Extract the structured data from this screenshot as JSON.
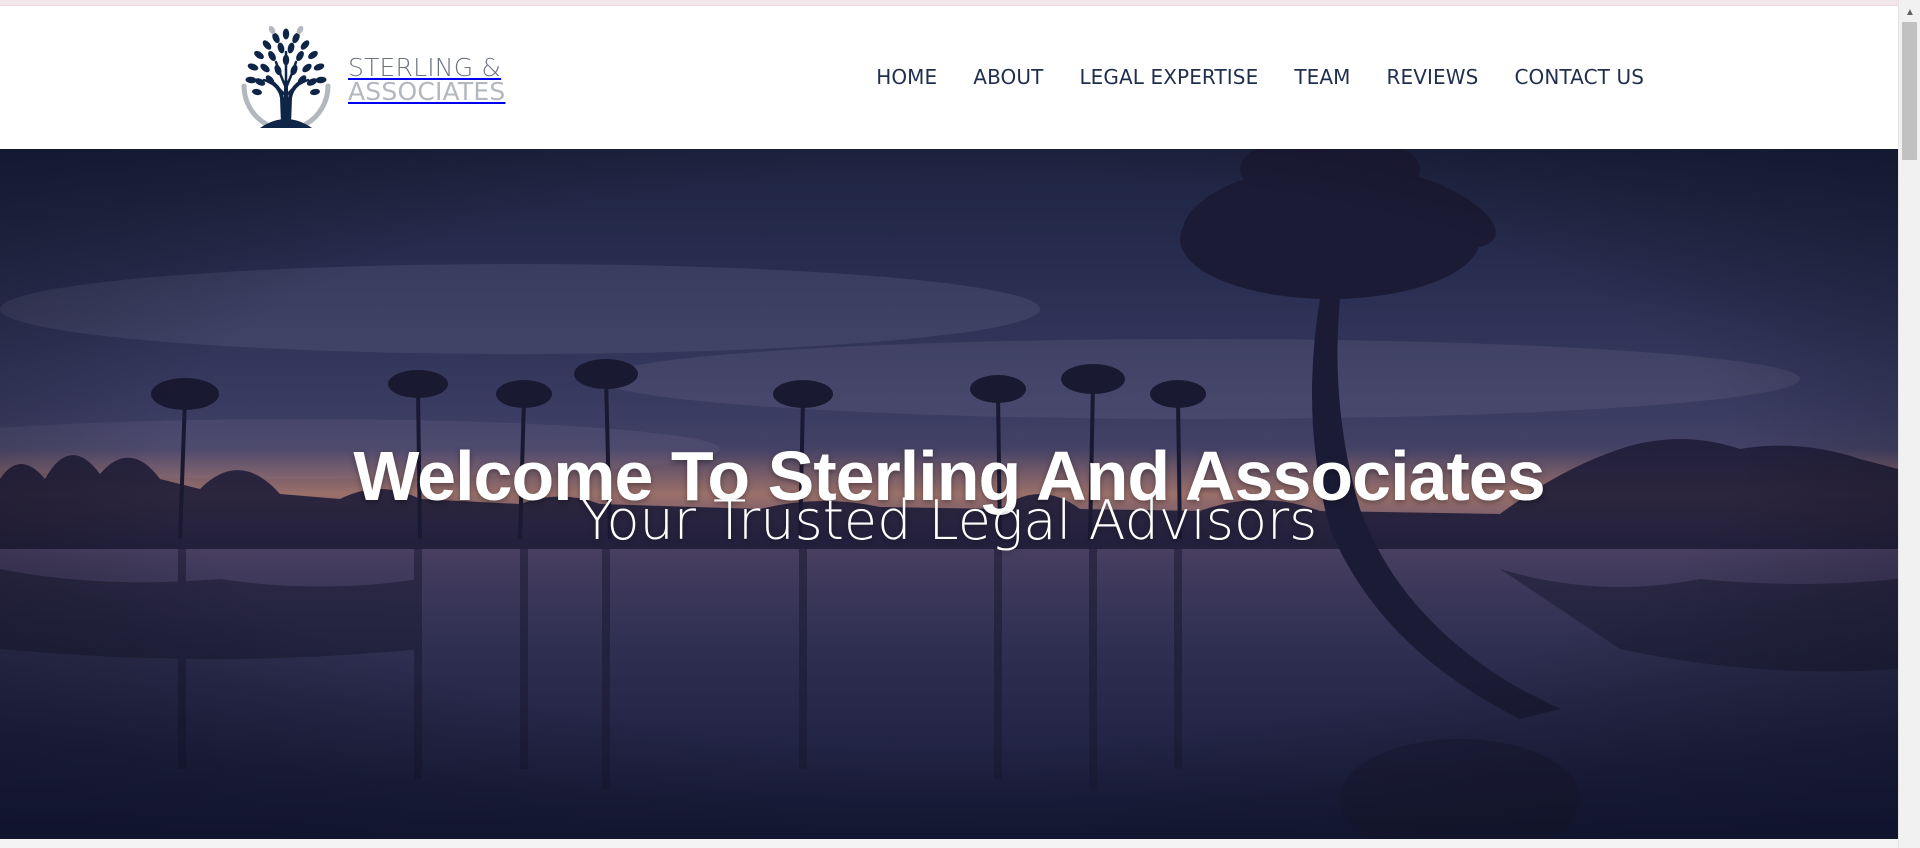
{
  "brand": {
    "line1": "STERLING &",
    "line2": "ASSOCIATES",
    "logo_icon": "tree-icon",
    "colors": {
      "navy": "#0f2547",
      "grey": "#b3b7be"
    }
  },
  "nav": {
    "items": [
      {
        "label": "HOME"
      },
      {
        "label": "ABOUT"
      },
      {
        "label": "LEGAL EXPERTISE"
      },
      {
        "label": "TEAM"
      },
      {
        "label": "REVIEWS"
      },
      {
        "label": "CONTACT US"
      }
    ],
    "text_color": "#1f2f4d"
  },
  "hero": {
    "title": "Welcome To Sterling And Associates",
    "subtitle": "Your Trusted Legal Advisors",
    "background": "night-palm-lake-photo"
  },
  "scrollbar": {
    "up_arrow_icon": "chevron-up-icon"
  }
}
